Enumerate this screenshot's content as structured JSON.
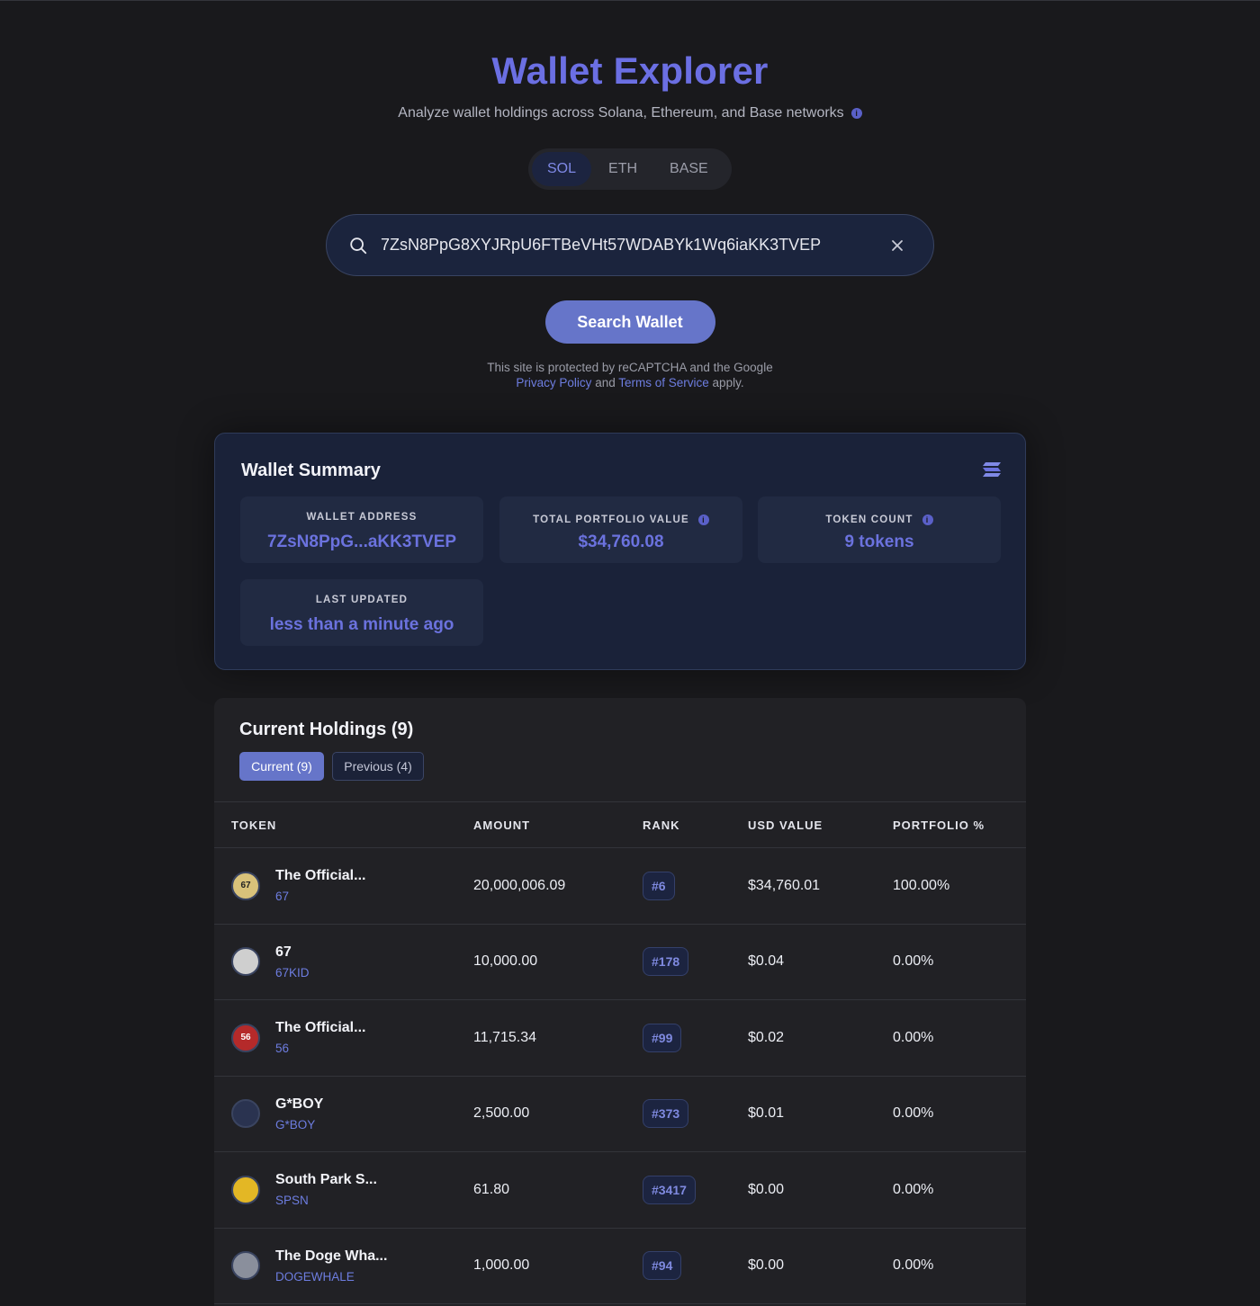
{
  "header": {
    "title": "Wallet Explorer",
    "subtitle": "Analyze wallet holdings across Solana, Ethereum, and Base networks",
    "info_icon": "i"
  },
  "networks": [
    {
      "label": "SOL",
      "active": true
    },
    {
      "label": "ETH",
      "active": false
    },
    {
      "label": "BASE",
      "active": false
    }
  ],
  "search": {
    "value": "7ZsN8PpG8XYJRpU6FTBeVHt57WDABYk1Wq6iaKK3TVEP",
    "placeholder": "",
    "button_label": "Search Wallet"
  },
  "recaptcha": {
    "line1": "This site is protected by reCAPTCHA and the Google",
    "privacy": "Privacy Policy",
    "and": "and",
    "terms": "Terms of Service",
    "apply": "apply."
  },
  "summary": {
    "title": "Wallet Summary",
    "wallet_address_label": "WALLET ADDRESS",
    "wallet_address_value": "7ZsN8PpG...aKK3TVEP",
    "total_value_label": "TOTAL PORTFOLIO VALUE",
    "total_value": "$34,760.08",
    "token_count_label": "TOKEN COUNT",
    "token_count": "9 tokens",
    "last_updated_label": "LAST UPDATED",
    "last_updated": "less than a minute ago"
  },
  "holdings": {
    "title": "Current Holdings (9)",
    "tab_current": "Current (9)",
    "tab_previous": "Previous (4)",
    "columns": [
      "TOKEN",
      "AMOUNT",
      "RANK",
      "USD VALUE",
      "PORTFOLIO %"
    ],
    "rows": [
      {
        "name": "The Official...",
        "symbol": "67",
        "amount": "20,000,006.09",
        "rank": "#6",
        "usd": "$34,760.01",
        "pct": "100.00%",
        "avatar_text": "67",
        "avatar_color": "#d9c27a"
      },
      {
        "name": "67",
        "symbol": "67KID",
        "amount": "10,000.00",
        "rank": "#178",
        "usd": "$0.04",
        "pct": "0.00%",
        "avatar_text": "",
        "avatar_color": "#cfcfcf"
      },
      {
        "name": "The Official...",
        "symbol": "56",
        "amount": "11,715.34",
        "rank": "#99",
        "usd": "$0.02",
        "pct": "0.00%",
        "avatar_text": "56",
        "avatar_color": "#b52a2a"
      },
      {
        "name": "G*BOY",
        "symbol": "G*BOY",
        "amount": "2,500.00",
        "rank": "#373",
        "usd": "$0.01",
        "pct": "0.00%",
        "avatar_text": "",
        "avatar_color": "#2a3350"
      },
      {
        "name": "South Park S...",
        "symbol": "SPSN",
        "amount": "61.80",
        "rank": "#3417",
        "usd": "$0.00",
        "pct": "0.00%",
        "avatar_text": "",
        "avatar_color": "#e3b725"
      },
      {
        "name": "The Doge Wha...",
        "symbol": "DOGEWHALE",
        "amount": "1,000.00",
        "rank": "#94",
        "usd": "$0.00",
        "pct": "0.00%",
        "avatar_text": "",
        "avatar_color": "#8a8f9c"
      }
    ]
  },
  "colors": {
    "accent": "#6b6fe3",
    "button": "#6675c9",
    "link": "#6d7de0",
    "background": "#19191c"
  }
}
